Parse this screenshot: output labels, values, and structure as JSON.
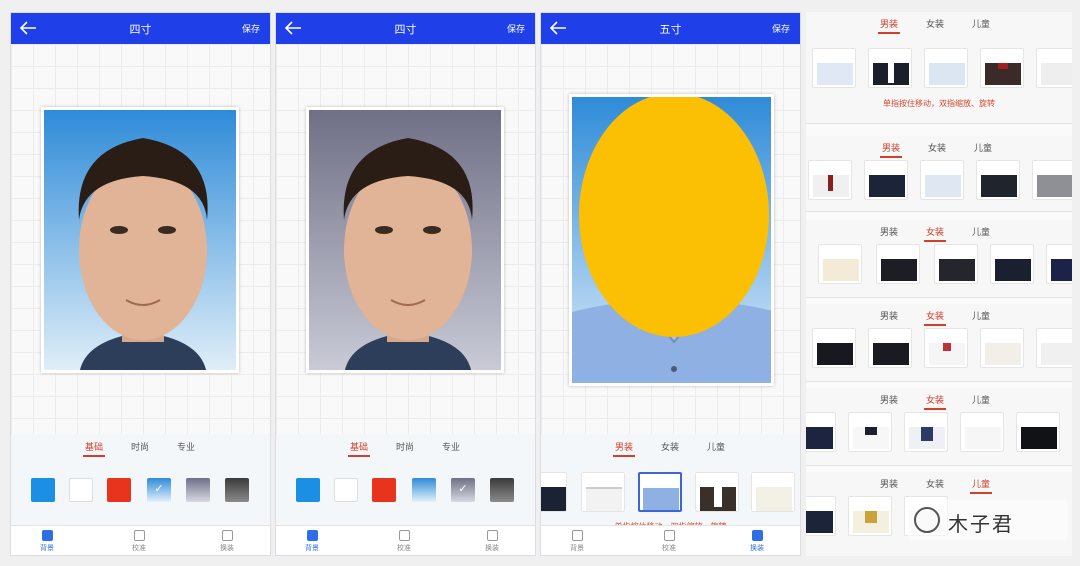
{
  "panels": [
    {
      "title": "四寸",
      "save_label": "保存",
      "tabs": [
        "基础",
        "时尚",
        "专业"
      ],
      "active_tab": 0,
      "swatches": [
        {
          "color": "#1a8fe3"
        },
        {
          "color": "#ffffff"
        },
        {
          "color": "#e8331d"
        },
        {
          "color": "gradient-blue",
          "selected": true
        },
        {
          "color": "gradient-gray"
        },
        {
          "color": "gradient-dark"
        }
      ],
      "nav": [
        "背景",
        "校准",
        "换装"
      ],
      "active_nav": 0
    },
    {
      "title": "四寸",
      "save_label": "保存",
      "tabs": [
        "基础",
        "时尚",
        "专业"
      ],
      "active_tab": 0,
      "swatches": [
        {
          "color": "#1a8fe3"
        },
        {
          "color": "#ffffff"
        },
        {
          "color": "#e8331d"
        },
        {
          "color": "gradient-blue"
        },
        {
          "color": "gradient-gray",
          "selected": true
        },
        {
          "color": "gradient-dark"
        }
      ],
      "nav": [
        "背景",
        "校准",
        "换装"
      ],
      "active_nav": 0
    },
    {
      "title": "五寸",
      "save_label": "保存",
      "tabs": [
        "男装",
        "女装",
        "儿童"
      ],
      "active_tab": 0,
      "hint": "单指按住移动，双指缩放、旋转",
      "nav": [
        "背景",
        "校准",
        "换装"
      ],
      "active_nav": 2
    }
  ],
  "strips": [
    {
      "tabs": [
        "男装",
        "女装",
        "儿童"
      ],
      "active_tab": 0,
      "hint": "单指按住移动，双指缩放、旋转"
    },
    {
      "tabs": [
        "男装",
        "女装",
        "儿童"
      ],
      "active_tab": 0
    },
    {
      "tabs": [
        "男装",
        "女装",
        "儿童"
      ],
      "active_tab": 1
    },
    {
      "tabs": [
        "男装",
        "女装",
        "儿童"
      ],
      "active_tab": 1
    },
    {
      "tabs": [
        "男装",
        "女装",
        "儿童"
      ],
      "active_tab": 1
    },
    {
      "tabs": [
        "男装",
        "女装",
        "儿童"
      ],
      "active_tab": 2
    }
  ],
  "watermark": "木子君",
  "colors": {
    "topbar": "#1f3fe8",
    "accent": "#d23f2c",
    "nav_active": "#2f6fe6",
    "face_mask": "#fbbf04"
  }
}
